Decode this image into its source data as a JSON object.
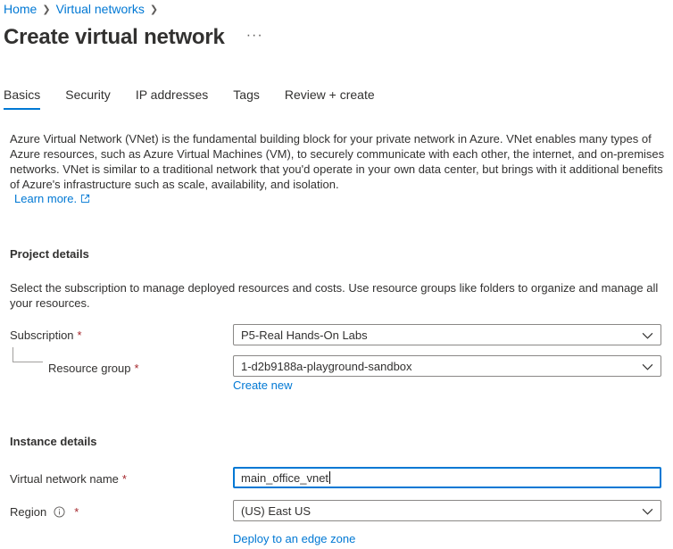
{
  "breadcrumb": {
    "items": [
      "Home",
      "Virtual networks"
    ]
  },
  "header": {
    "title": "Create virtual network",
    "more": "···"
  },
  "tabs": [
    "Basics",
    "Security",
    "IP addresses",
    "Tags",
    "Review + create"
  ],
  "intro": {
    "text": "Azure Virtual Network (VNet) is the fundamental building block for your private network in Azure. VNet enables many types of Azure resources, such as Azure Virtual Machines (VM), to securely communicate with each other, the internet, and on-premises networks. VNet is similar to a traditional network that you'd operate in your own data center, but brings with it additional benefits of Azure's infrastructure such as scale, availability, and isolation.",
    "learn_more": "Learn more."
  },
  "project_details": {
    "heading": "Project details",
    "description": "Select the subscription to manage deployed resources and costs. Use resource groups like folders to organize and manage all your resources.",
    "subscription_label": "Subscription",
    "subscription_value": "P5-Real Hands-On Labs",
    "resource_group_label": "Resource group",
    "resource_group_value": "1-d2b9188a-playground-sandbox",
    "create_new": "Create new"
  },
  "instance_details": {
    "heading": "Instance details",
    "vnet_name_label": "Virtual network name",
    "vnet_name_value": "main_office_vnet",
    "region_label": "Region",
    "region_value": "(US) East US",
    "edge_zone_link": "Deploy to an edge zone"
  },
  "required_marker": "*",
  "icons": {
    "breadcrumb_separator": "chevron-right-icon",
    "external_link": "external-link-icon",
    "dropdown": "chevron-down-icon",
    "info": "info-icon"
  },
  "colors": {
    "accent": "#0078d4",
    "required": "#a4262c",
    "text": "#323130"
  }
}
